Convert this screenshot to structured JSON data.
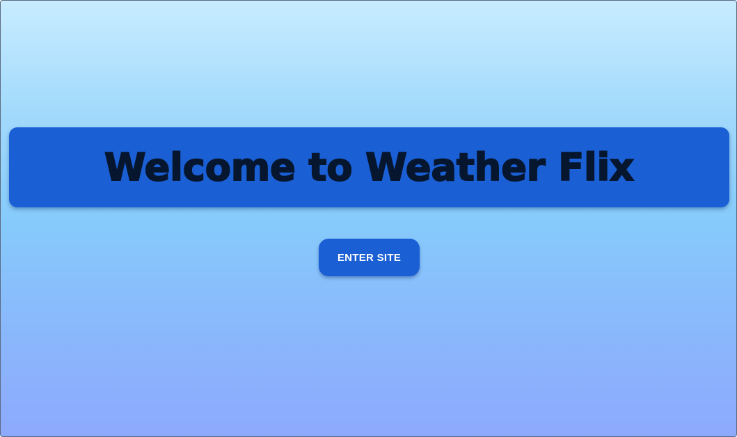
{
  "hero": {
    "title": "Welcome to Weather Flix"
  },
  "actions": {
    "enter_label": "ENTER SITE"
  },
  "colors": {
    "banner": "#1a5fd4",
    "button": "#1a5fd4",
    "title_text": "#06162e",
    "button_text": "#ffffff",
    "background_top": "#c8ecff",
    "background_bottom": "#8da9fd"
  }
}
